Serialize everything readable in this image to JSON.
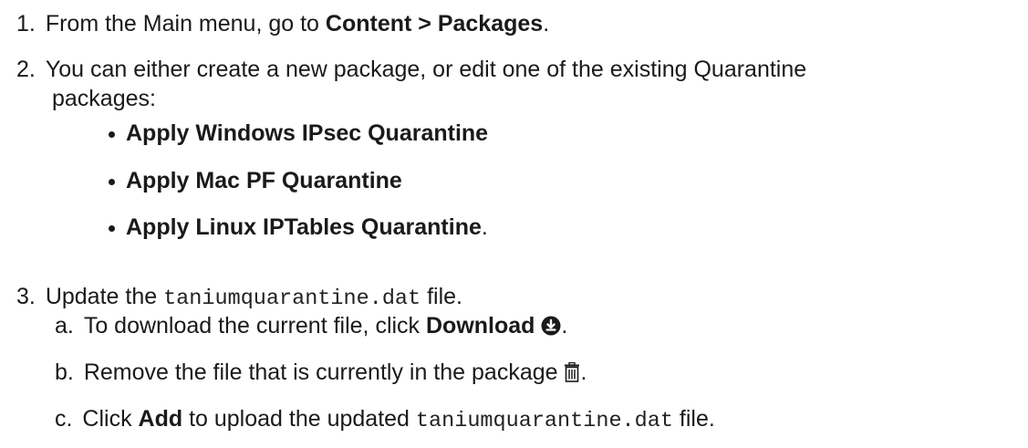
{
  "steps": {
    "s1": {
      "num": "1.",
      "pre": "From the Main menu, go to ",
      "bold": "Content > Packages",
      "post": "."
    },
    "s2": {
      "num": "2.",
      "line1": "You can either create a new package, or edit one of the existing Quarantine",
      "line2": "packages:",
      "bullets": [
        {
          "bold": "Apply Windows IPsec Quarantine",
          "post": ""
        },
        {
          "bold": "Apply Mac PF Quarantine",
          "post": ""
        },
        {
          "bold": "Apply Linux IPTables Quarantine",
          "post": "."
        }
      ]
    },
    "s3": {
      "num": "3.",
      "pre": "Update the ",
      "code": "taniumquarantine.dat",
      "post": " file.",
      "sub": {
        "a": {
          "letter": "a.",
          "pre": "To download the current file, click ",
          "bold": "Download",
          "post": ".",
          "icon": "download-circle-icon"
        },
        "b": {
          "letter": "b.",
          "pre": "Remove the file that is currently in the package ",
          "post": ".",
          "icon": "trash-icon"
        },
        "c": {
          "letter": "c.",
          "pre": "Click ",
          "bold": "Add",
          "mid": " to upload the updated ",
          "code": "taniumquarantine.dat",
          "post": " file."
        }
      }
    }
  }
}
